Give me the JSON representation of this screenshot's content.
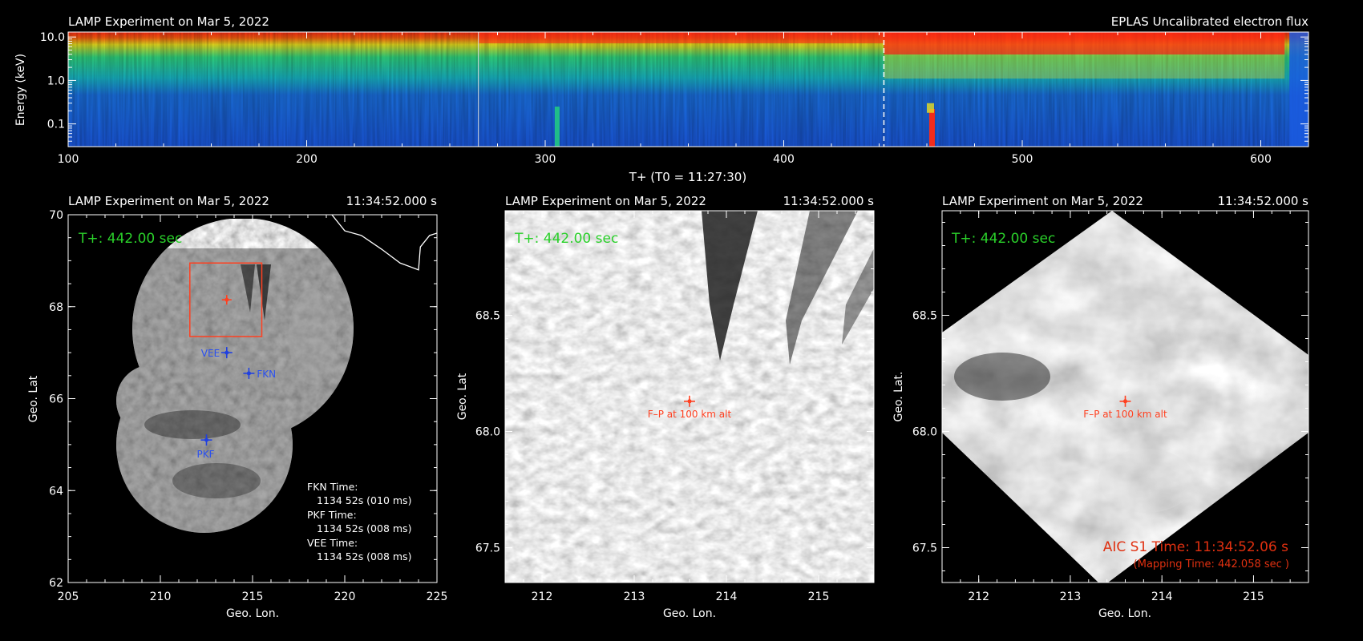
{
  "chart_data": [
    {
      "type": "heatmap",
      "title_left": "LAMP Experiment on Mar 5, 2022",
      "title_right": "EPLAS Uncalibrated electron flux",
      "xlabel": "T+ (T0 = 11:27:30)",
      "ylabel": "Energy (keV)",
      "xlim": [
        100,
        620
      ],
      "x_ticks": [
        100,
        200,
        300,
        400,
        500,
        600
      ],
      "y_ticks": [
        {
          "value": 10.0,
          "label": "10.0"
        },
        {
          "value": 1.0,
          "label": "1.0"
        },
        {
          "value": 0.1,
          "label": "0.1"
        }
      ],
      "ylim": [
        0.03,
        13.0
      ],
      "y_scale": "log",
      "current_time": 442,
      "colors": {
        "low": "#1a5ae0",
        "mid": "#22d080",
        "high": "#ff2a14"
      }
    },
    {
      "type": "scatter",
      "title_left": "LAMP Experiment on Mar 5, 2022",
      "title_right": "11:34:52.000 s",
      "time_label": "T+: 442.00 sec",
      "xlabel": "Geo. Lon.",
      "ylabel": "Geo. Lat",
      "xlim": [
        205,
        225
      ],
      "ylim": [
        62,
        70
      ],
      "x_ticks": [
        "205",
        "210",
        "215",
        "220",
        "225"
      ],
      "y_ticks": [
        "62",
        "64",
        "66",
        "68",
        "70"
      ],
      "stations": [
        {
          "name": "VEE",
          "lon": 213.6,
          "lat": 67.0
        },
        {
          "name": "FKN",
          "lon": 214.8,
          "lat": 66.55
        },
        {
          "name": "PKF",
          "lon": 212.5,
          "lat": 65.1
        }
      ],
      "footpoint": {
        "lon": 213.6,
        "lat": 68.15
      },
      "zoom_box": {
        "lon_min": 211.6,
        "lon_max": 215.5,
        "lat_min": 67.35,
        "lat_max": 68.95
      },
      "coastline": [
        [
          219.3,
          70.0
        ],
        [
          220.0,
          69.65
        ],
        [
          220.9,
          69.55
        ],
        [
          222.0,
          69.25
        ],
        [
          223.0,
          68.95
        ],
        [
          224.0,
          68.8
        ],
        [
          224.1,
          69.3
        ],
        [
          224.6,
          69.55
        ],
        [
          225.0,
          69.6
        ]
      ],
      "times": [
        {
          "label": "FKN Time:",
          "value": "1134 52s (010 ms)"
        },
        {
          "label": "PKF Time:",
          "value": "1134 52s (008 ms)"
        },
        {
          "label": "VEE Time:",
          "value": "1134 52s (008 ms)"
        }
      ]
    },
    {
      "type": "scatter",
      "title_left": "LAMP Experiment on Mar 5, 2022",
      "title_right": "11:34:52.000 s",
      "time_label": "T+: 442.00 sec",
      "xlabel": "Geo. Lon.",
      "ylabel": "Geo. Lat",
      "xlim": [
        211.6,
        215.6
      ],
      "ylim": [
        67.35,
        68.95
      ],
      "x_ticks": [
        "212",
        "213",
        "214",
        "215"
      ],
      "y_ticks": [
        "67.5",
        "68.0",
        "68.5"
      ],
      "footpoint": {
        "lon": 213.6,
        "lat": 68.13,
        "label": "F–P at 100 km alt"
      }
    },
    {
      "type": "scatter",
      "title_left": "LAMP Experiment on Mar 5, 2022",
      "title_right": "11:34:52.000 s",
      "time_label": "T+: 442.00 sec",
      "xlabel": "Geo. Lon.",
      "ylabel": "Geo. Lat.",
      "xlim": [
        211.6,
        215.6
      ],
      "ylim": [
        67.35,
        68.95
      ],
      "x_ticks": [
        "212",
        "213",
        "214",
        "215"
      ],
      "y_ticks": [
        "67.5",
        "68.0",
        "68.5"
      ],
      "footpoint": {
        "lon": 213.6,
        "lat": 68.13,
        "label": "F–P at 100 km alt"
      },
      "aic_time": "AIC S1 Time: 11:34:52.06 s",
      "mapping_time": "(Mapping Time: 442.058 sec )"
    }
  ]
}
